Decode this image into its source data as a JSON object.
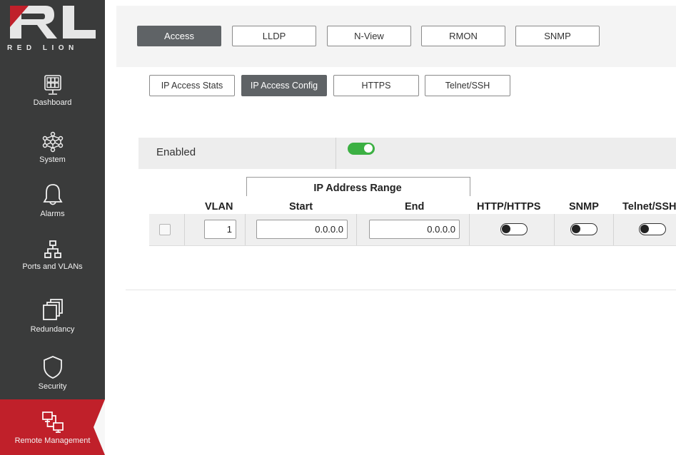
{
  "brand": {
    "logo_text": "RED LION"
  },
  "sidebar": {
    "items": [
      {
        "label": "Dashboard",
        "icon": "dashboard-icon"
      },
      {
        "label": "System",
        "icon": "network-nodes-icon"
      },
      {
        "label": "Alarms",
        "icon": "bell-icon"
      },
      {
        "label": "Ports and VLANs",
        "icon": "ports-tree-icon"
      },
      {
        "label": "Redundancy",
        "icon": "stacked-windows-icon"
      },
      {
        "label": "Security",
        "icon": "shield-icon"
      },
      {
        "label": "Remote Management",
        "icon": "remote-monitors-icon",
        "active": true
      }
    ]
  },
  "top_tabs": [
    {
      "label": "Access",
      "selected": true
    },
    {
      "label": "LLDP"
    },
    {
      "label": "N-View"
    },
    {
      "label": "RMON"
    },
    {
      "label": "SNMP"
    }
  ],
  "sub_tabs": [
    {
      "label": "IP Access Stats"
    },
    {
      "label": "IP Access Config",
      "selected": true
    },
    {
      "label": "HTTPS"
    },
    {
      "label": "Telnet/SSH"
    }
  ],
  "enabled": {
    "label": "Enabled",
    "on": true
  },
  "table": {
    "group_header": "IP Address Range",
    "headers": {
      "vlan": "VLAN",
      "start": "Start",
      "end": "End",
      "http": "HTTP/HTTPS",
      "snmp": "SNMP",
      "telnet": "Telnet/SSH"
    },
    "row": {
      "vlan": "1",
      "start": "0.0.0.0",
      "end": "0.0.0.0",
      "http_on": false,
      "snmp_on": false,
      "telnet_on": false
    }
  },
  "colors": {
    "sidebar_bg": "#3a3b3b",
    "active_red": "#c0202a",
    "toggle_on": "#3cb043",
    "selected_tab": "#5f6366"
  }
}
